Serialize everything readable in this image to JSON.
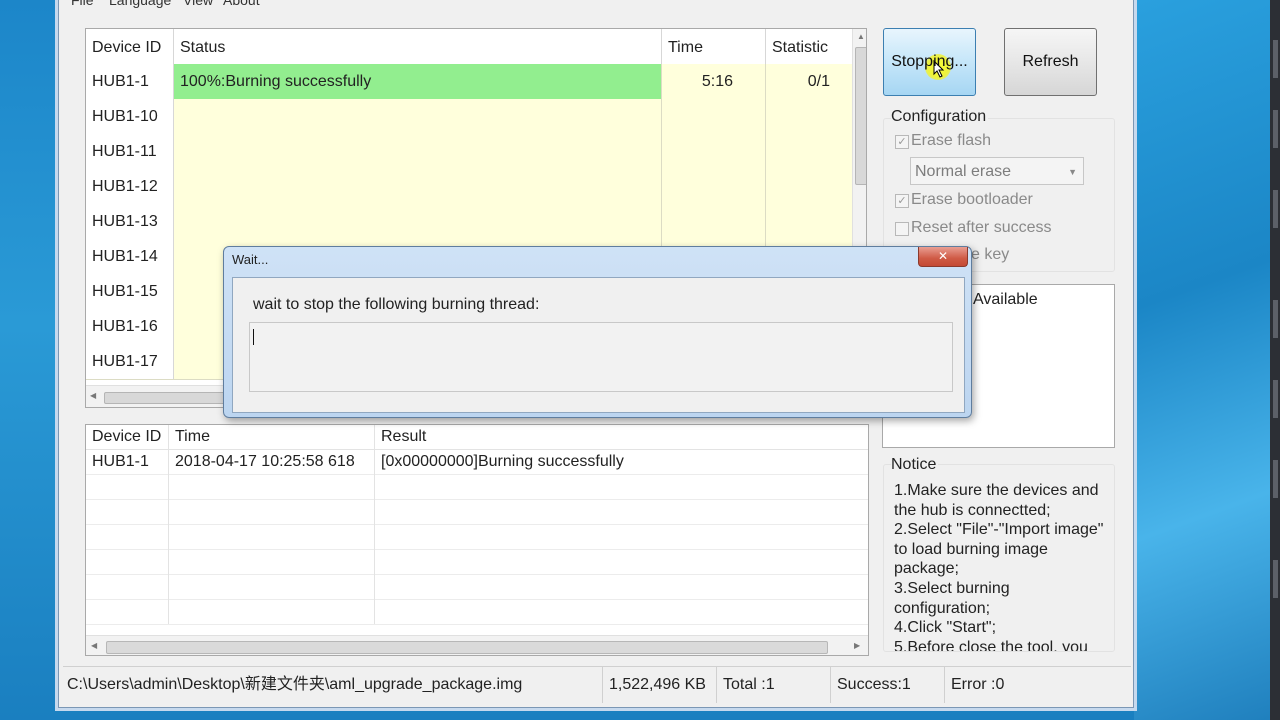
{
  "menu": [
    "File",
    "Language",
    "View",
    "About"
  ],
  "device_grid": {
    "columns": [
      "Device ID",
      "Status",
      "Time",
      "Statistic"
    ],
    "rows": [
      {
        "id": "HUB1-1",
        "status": "100%:Burning successfully",
        "time": "5:16",
        "stat": "0/1",
        "success": true
      },
      {
        "id": "HUB1-10",
        "status": "",
        "time": "",
        "stat": "",
        "success": false
      },
      {
        "id": "HUB1-11",
        "status": "",
        "time": "",
        "stat": "",
        "success": false
      },
      {
        "id": "HUB1-12",
        "status": "",
        "time": "",
        "stat": "",
        "success": false
      },
      {
        "id": "HUB1-13",
        "status": "",
        "time": "",
        "stat": "",
        "success": false
      },
      {
        "id": "HUB1-14",
        "status": "",
        "time": "",
        "stat": "",
        "success": false
      },
      {
        "id": "HUB1-15",
        "status": "",
        "time": "",
        "stat": "",
        "success": false
      },
      {
        "id": "HUB1-16",
        "status": "",
        "time": "",
        "stat": "",
        "success": false
      },
      {
        "id": "HUB1-17",
        "status": "",
        "time": "",
        "stat": "",
        "success": false
      }
    ]
  },
  "log": {
    "columns": [
      "Device ID",
      "Time",
      "Result"
    ],
    "rows": [
      {
        "id": "HUB1-1",
        "time": "2018-04-17 10:25:58 618",
        "result": "[0x00000000]Burning successfully"
      }
    ]
  },
  "buttons": {
    "stop": "Stopping...",
    "refresh": "Refresh"
  },
  "configuration": {
    "title": "Configuration",
    "erase_flash": "Erase flash",
    "erase_mode": "Normal erase",
    "erase_bootloader": "Erase bootloader",
    "reset_after_success": "Reset after success",
    "partial_key": "e key"
  },
  "available": {
    "header": "Available"
  },
  "notice": {
    "title": "Notice",
    "text": "1.Make sure the devices and the hub is connectted;\n2.Select \"File\"-\"Import image\" to load burning image package;\n3.Select burning configuration;\n4.Click \"Start\";\n5.Before close the tool, you"
  },
  "status_bar": {
    "path": "C:\\Users\\admin\\Desktop\\新建文件夹\\aml_upgrade_package.img",
    "size": "1,522,496 KB",
    "total": "Total :1",
    "success": "Success:1",
    "error": "Error :0"
  },
  "dialog": {
    "title": "Wait...",
    "close": "✕",
    "message": "wait to stop the following burning thread:"
  },
  "colors": {
    "success_row": "#92ee8f",
    "empty_row": "#ffffdc",
    "desktop": "#1c86c9"
  }
}
